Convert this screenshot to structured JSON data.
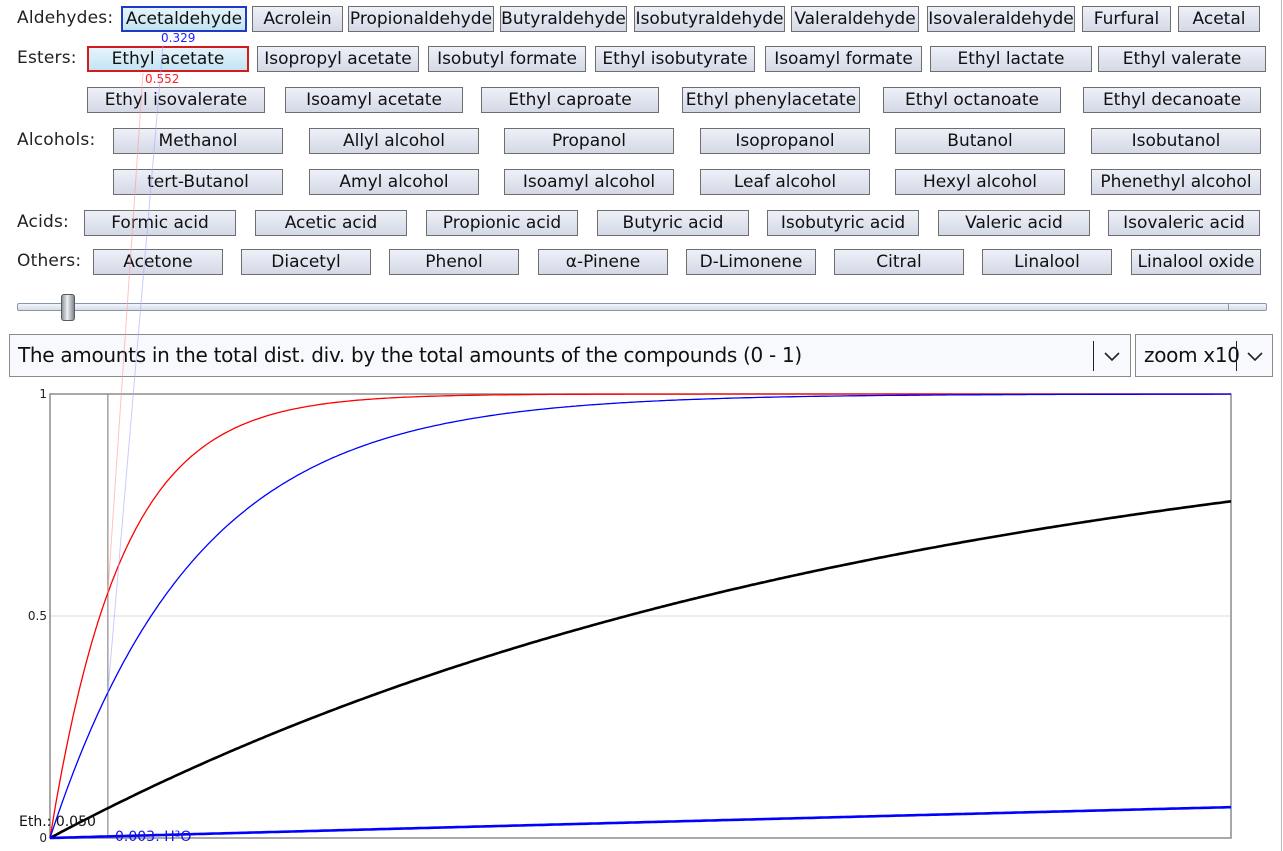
{
  "categories": [
    {
      "label": "Aldehydes:",
      "rows": [
        [
          {
            "label": "Acetaldehyde",
            "state": "selected-blue"
          },
          {
            "label": "Acrolein"
          },
          {
            "label": "Propionaldehyde"
          },
          {
            "label": "Butyraldehyde"
          },
          {
            "label": "Isobutyraldehyde"
          },
          {
            "label": "Valeraldehyde"
          },
          {
            "label": "Isovaleraldehyde"
          },
          {
            "label": "Furfural"
          },
          {
            "label": "Acetal"
          }
        ]
      ]
    },
    {
      "label": "Esters:",
      "rows": [
        [
          {
            "label": "Ethyl acetate",
            "state": "selected-red"
          },
          {
            "label": "Isopropyl acetate"
          },
          {
            "label": "Isobutyl formate"
          },
          {
            "label": "Ethyl isobutyrate"
          },
          {
            "label": "Isoamyl formate"
          },
          {
            "label": "Ethyl lactate"
          },
          {
            "label": "Ethyl valerate"
          }
        ],
        [
          {
            "label": "Ethyl isovalerate"
          },
          {
            "label": "Isoamyl acetate"
          },
          {
            "label": "Ethyl caproate"
          },
          {
            "label": "Ethyl phenylacetate"
          },
          {
            "label": "Ethyl octanoate"
          },
          {
            "label": "Ethyl decanoate"
          }
        ]
      ]
    },
    {
      "label": "Alcohols:",
      "rows": [
        [
          {
            "label": "Methanol"
          },
          {
            "label": "Allyl alcohol"
          },
          {
            "label": "Propanol"
          },
          {
            "label": "Isopropanol"
          },
          {
            "label": "Butanol"
          },
          {
            "label": "Isobutanol"
          }
        ],
        [
          {
            "label": "tert-Butanol"
          },
          {
            "label": "Amyl alcohol"
          },
          {
            "label": "Isoamyl alcohol"
          },
          {
            "label": "Leaf alcohol"
          },
          {
            "label": "Hexyl alcohol"
          },
          {
            "label": "Phenethyl alcohol"
          }
        ]
      ]
    },
    {
      "label": "Acids:",
      "rows": [
        [
          {
            "label": "Formic acid"
          },
          {
            "label": "Acetic acid"
          },
          {
            "label": "Propionic acid"
          },
          {
            "label": "Butyric acid"
          },
          {
            "label": "Isobutyric acid"
          },
          {
            "label": "Valeric acid"
          },
          {
            "label": "Isovaleric acid"
          }
        ]
      ]
    },
    {
      "label": "Others:",
      "rows": [
        [
          {
            "label": "Acetone"
          },
          {
            "label": "Diacetyl"
          },
          {
            "label": "Phenol"
          },
          {
            "label": "α-Pinene"
          },
          {
            "label": "D-Limonene"
          },
          {
            "label": "Citral"
          },
          {
            "label": "Linalool"
          },
          {
            "label": "Linalool oxide"
          }
        ]
      ]
    }
  ],
  "selection_values": {
    "acetaldehyde": "0.329",
    "ethyl_acetate": "0.552"
  },
  "slider": {
    "fraction": 0.035
  },
  "mode_select": {
    "value": "The amounts in the total dist. div. by the total amounts of the compounds (0 - 1)"
  },
  "zoom_select": {
    "value": "zoom x10"
  },
  "colors": {
    "ethyl_acetate": "#ff0000",
    "acetaldehyde": "#0000ff",
    "ethanol": "#000000",
    "water": "#0000ff"
  },
  "chart_data": {
    "type": "line",
    "title": "",
    "xlabel": "",
    "ylabel": "",
    "xlim": [
      0,
      1
    ],
    "ylim": [
      0,
      1
    ],
    "y_ticks": [
      "0",
      "0.5",
      "1"
    ],
    "grid": "horizontal at 0.5",
    "marker_x": 0.049,
    "series": [
      {
        "name": "Ethyl acetate",
        "color": "#ff0000",
        "width": "thin",
        "model": "1-exp(-k*x)",
        "k": 16.4,
        "value_at_marker": "0.552"
      },
      {
        "name": "Acetaldehyde",
        "color": "#0000ff",
        "width": "thin",
        "model": "1-exp(-k*x)",
        "k": 8.1,
        "value_at_marker": "0.329"
      },
      {
        "name": "Ethanol",
        "color": "#000000",
        "width": "thick",
        "model": "1-exp(-k*x)",
        "k": 1.42,
        "value_at_marker": "0.050",
        "end_value": 0.78
      },
      {
        "name": "Water",
        "color": "#0000ff",
        "width": "thick",
        "model": "1-exp(-k*x)",
        "k": 0.072,
        "value_at_marker": "0.003",
        "end_value": 0.07
      }
    ],
    "annotations": {
      "ethanol_label": "Eth.: 0.050",
      "water_label": "0.003: H²O"
    }
  }
}
